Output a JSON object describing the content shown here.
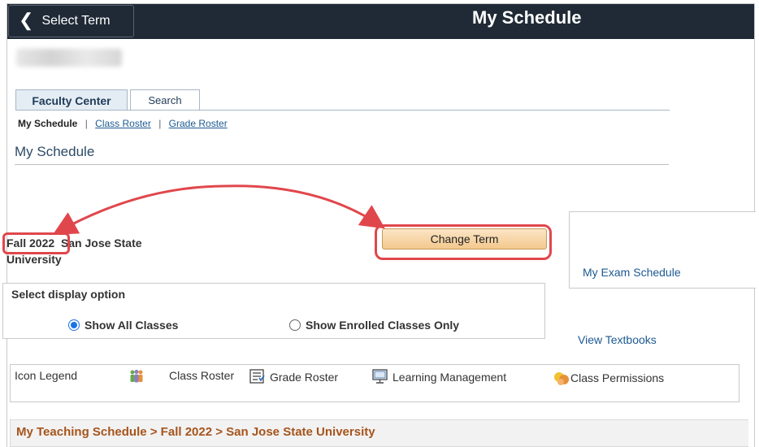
{
  "header": {
    "back_label": "Select Term",
    "title": "My Schedule"
  },
  "tabs": [
    {
      "label": "Faculty Center",
      "active": true
    },
    {
      "label": "Search",
      "active": false
    }
  ],
  "subnav": {
    "current": "My Schedule",
    "links": [
      "Class Roster",
      "Grade Roster"
    ],
    "separator": "|"
  },
  "page": {
    "heading": "My Schedule",
    "term": "Fall 2022",
    "institution": "San Jose State University",
    "change_term_label": "Change Term"
  },
  "side_links": {
    "exam_schedule": "My Exam Schedule",
    "textbooks": "View Textbooks"
  },
  "display_option": {
    "title": "Select display option",
    "options": [
      {
        "label": "Show All Classes",
        "selected": true
      },
      {
        "label": "Show Enrolled Classes Only",
        "selected": false
      }
    ]
  },
  "legend": {
    "title": "Icon Legend",
    "items": [
      {
        "label": "Class Roster",
        "icon": "class-roster-icon"
      },
      {
        "label": "Grade Roster",
        "icon": "grade-roster-icon"
      },
      {
        "label": "Learning Management",
        "icon": "learning-management-icon"
      },
      {
        "label": "Class Permissions",
        "icon": "class-permissions-icon"
      }
    ]
  },
  "schedule": {
    "title": "My Teaching Schedule > Fall 2022 > San Jose State University"
  },
  "colors": {
    "header_bg": "#1f2a36",
    "link": "#1d5a92",
    "annotation_red": "#e0474c",
    "button_bg": "#f3c88d",
    "schedule_title": "#a6541c"
  }
}
